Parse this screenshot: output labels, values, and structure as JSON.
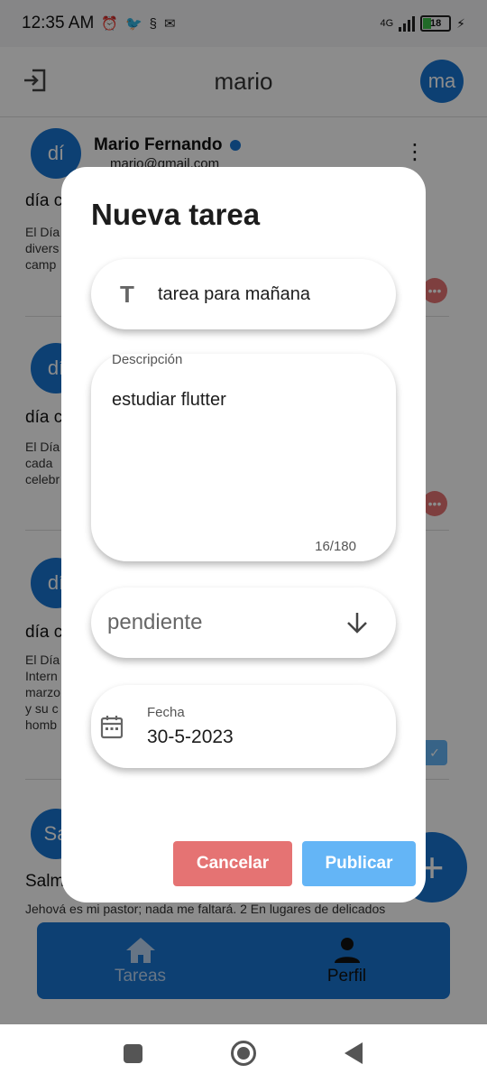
{
  "status_bar": {
    "time": "12:35 AM",
    "network": "4G",
    "battery": "18"
  },
  "app_bar": {
    "title": "mario",
    "avatar": "ma"
  },
  "feed": {
    "posts": [
      {
        "avatar": "dí",
        "name": "Mario Fernando",
        "email": "mario@gmail.com",
        "title": "día c",
        "body": "El Día                                                                 por\ndivers\ncamp"
      },
      {
        "avatar": "dí",
        "title": "día c",
        "body": "El Día\ncada\ncelebr"
      },
      {
        "avatar": "dí",
        "title": "día c",
        "body": "El Día                                                                  de\nIntern                                                                dad\nmarzo                                                                   el\ny su c\nhomb"
      },
      {
        "avatar": "Sa",
        "title": "Salm",
        "body": "Jehová es mi pastor; nada me faltará.  2 En lugares de delicados"
      }
    ]
  },
  "fab": {
    "label": "+"
  },
  "bottom_nav": {
    "items": [
      {
        "label": "Tareas"
      },
      {
        "label": "Perfil"
      }
    ]
  },
  "dialog": {
    "title": "Nueva tarea",
    "title_field": {
      "value": "tarea para mañana",
      "icon": "T"
    },
    "description": {
      "label": "Descripción",
      "value": "estudiar flutter",
      "counter": "16/180"
    },
    "status": {
      "value": "pendiente"
    },
    "date": {
      "label": "Fecha",
      "value": "30-5-2023"
    },
    "cancel_label": "Cancelar",
    "publish_label": "Publicar"
  },
  "colors": {
    "primary": "#1976d2",
    "cancel": "#e57373",
    "publish": "#64b5f6"
  }
}
